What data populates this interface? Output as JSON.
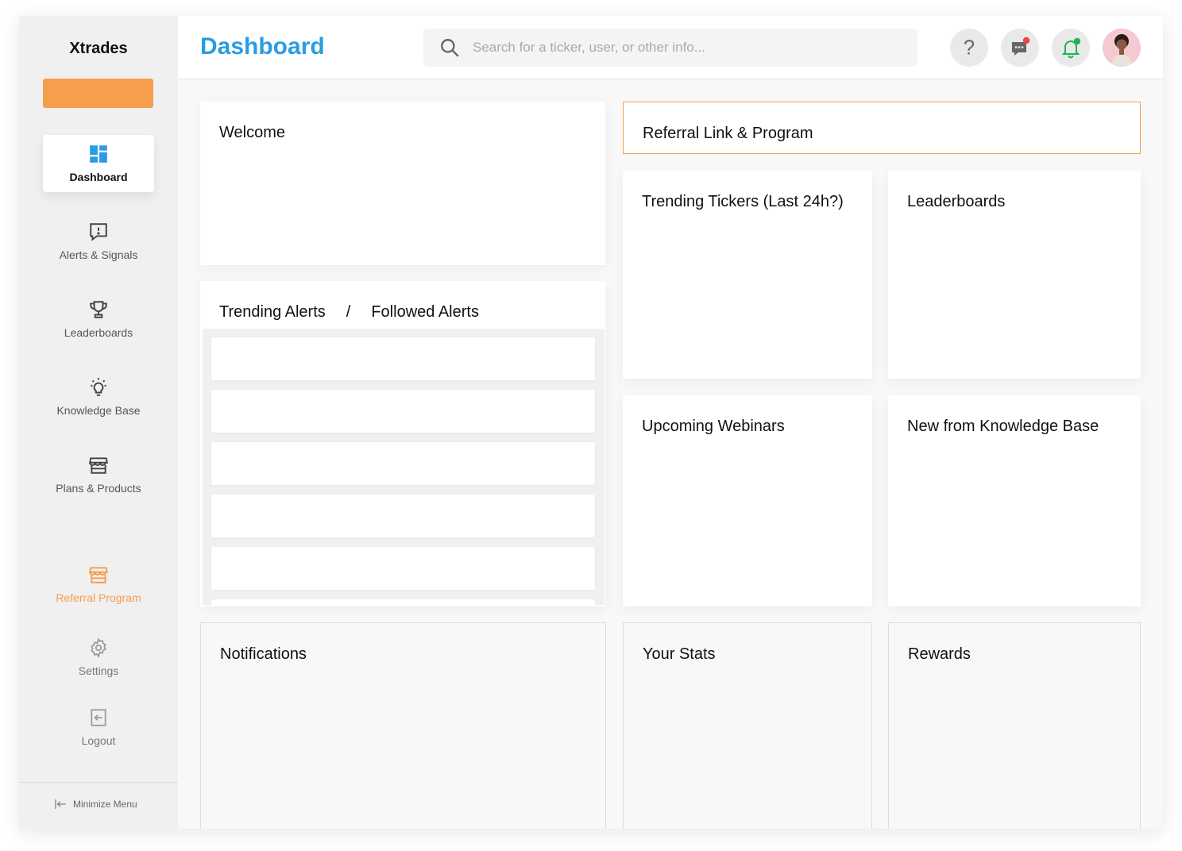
{
  "app": {
    "brand": "Xtrades"
  },
  "sidebar": {
    "items": [
      {
        "label": "Dashboard",
        "icon": "dashboard-icon",
        "active": true
      },
      {
        "label": "Alerts & Signals",
        "icon": "alert-message-icon"
      },
      {
        "label": "Leaderboards",
        "icon": "trophy-icon"
      },
      {
        "label": "Knowledge Base",
        "icon": "lightbulb-icon"
      },
      {
        "label": "Plans & Products",
        "icon": "store-icon"
      },
      {
        "label": "Referral Program",
        "icon": "store-icon",
        "accent": "#f59e4c"
      },
      {
        "label": "Settings",
        "icon": "gear-icon"
      },
      {
        "label": "Logout",
        "icon": "logout-icon"
      }
    ],
    "minimize_label": "Minimize Menu"
  },
  "header": {
    "title": "Dashboard",
    "search_placeholder": "Search for a ticker, user, or other info..."
  },
  "cards": {
    "welcome": "Welcome",
    "alerts_tab_trending": "Trending Alerts",
    "alerts_separator": "/",
    "alerts_tab_followed": "Followed Alerts",
    "referral": "Referral Link & Program",
    "trending_tickers": "Trending Tickers (Last 24h?)",
    "leaderboards": "Leaderboards",
    "webinars": "Upcoming Webinars",
    "knowledge": "New from Knowledge Base",
    "notifications": "Notifications",
    "stats": "Your Stats",
    "rewards": "Rewards"
  },
  "colors": {
    "accent_orange": "#f59e4c",
    "title_blue": "#2a9ce3",
    "notification_red": "#e84545",
    "notification_green": "#22b357"
  }
}
